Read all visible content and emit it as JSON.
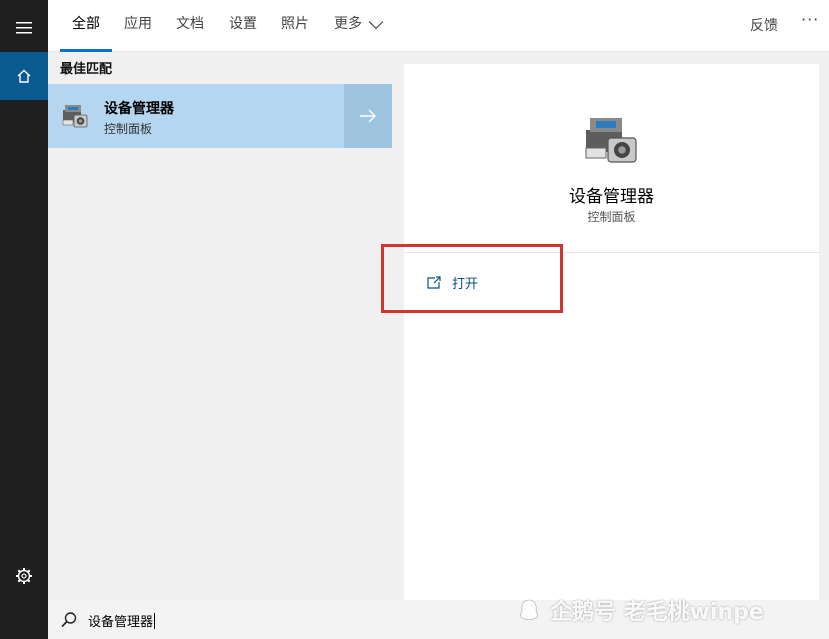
{
  "tabs": [
    {
      "label": "全部"
    },
    {
      "label": "应用"
    },
    {
      "label": "文档"
    },
    {
      "label": "设置"
    },
    {
      "label": "照片"
    },
    {
      "label": "更多"
    }
  ],
  "header": {
    "feedback_label": "反馈",
    "more_options_label": "···"
  },
  "best_match": {
    "section_label": "最佳匹配",
    "title": "设备管理器",
    "subtitle": "控制面板"
  },
  "detail": {
    "title": "设备管理器",
    "subtitle": "控制面板",
    "actions": [
      {
        "label": "打开",
        "icon": "open-external-icon"
      }
    ]
  },
  "search": {
    "value": "设备管理器"
  },
  "watermark": {
    "text": "企鹅号 老毛桃winpe"
  },
  "colors": {
    "rail_bg": "#1f1f1f",
    "rail_active": "#0a5a92",
    "tab_underline": "#0a72c4",
    "selected_result": "#b4d6f0",
    "highlight_box": "#d23333"
  }
}
